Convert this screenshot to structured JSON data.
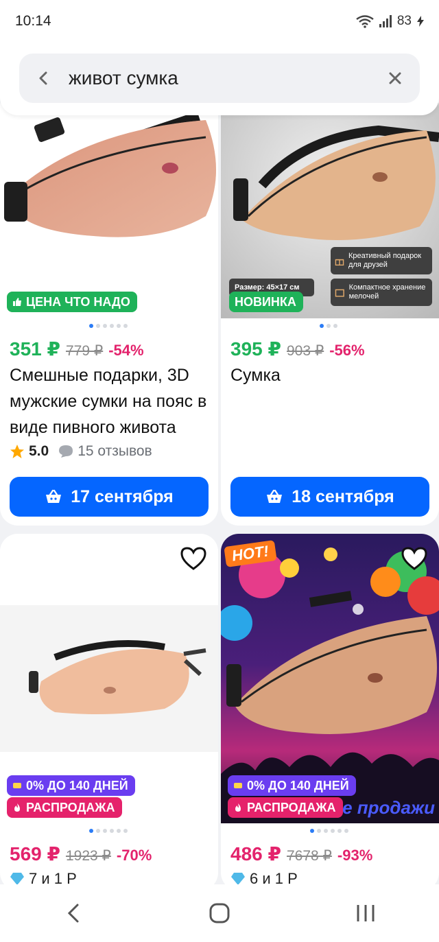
{
  "status_bar": {
    "time": "10:14",
    "battery": "83"
  },
  "search": {
    "query": "живот сумка"
  },
  "products": [
    {
      "badges": [
        "ЦЕНА ЧТО НАДО"
      ],
      "price": "351 ₽",
      "old_price": "779 ₽",
      "discount": "-54%",
      "title": "Смешные подарки, 3D мужские сумки на пояс в виде пивного живота",
      "rating": "5.0",
      "reviews": "15 отзывов",
      "delivery": "17 сентября",
      "price_color": "#1fb259"
    },
    {
      "badges": [
        "НОВИНКА"
      ],
      "overlay": {
        "size": "Размер: 45×17 см",
        "gift": "Креативный подарок для друзей",
        "storage": "Компактное хранение мелочей"
      },
      "price": "395 ₽",
      "old_price": "903 ₽",
      "discount": "-56%",
      "title": "Сумка",
      "delivery": "18 сентября",
      "price_color": "#1fb259"
    },
    {
      "badges": [
        "0% ДО 140 ДНЕЙ",
        "РАСПРОДАЖА"
      ],
      "price": "569 ₽",
      "old_price": "1923 ₽",
      "discount": "-70%",
      "points": "7 и 1 Р",
      "price_color": "#e3236c"
    },
    {
      "badges": [
        "0% ДО 140 ДНЕЙ",
        "РАСПРОДАЖА"
      ],
      "overlay": {
        "hot": "HOT!",
        "banner": "Горячие продажи"
      },
      "price": "486 ₽",
      "old_price": "7678 ₽",
      "discount": "-93%",
      "points": "6 и 1 Р",
      "price_color": "#e3236c"
    }
  ],
  "colors": {
    "accent": "#0566ff",
    "green_badge": "#1fb259",
    "purple_badge": "#6a3df0",
    "pink_badge": "#e5226b"
  }
}
